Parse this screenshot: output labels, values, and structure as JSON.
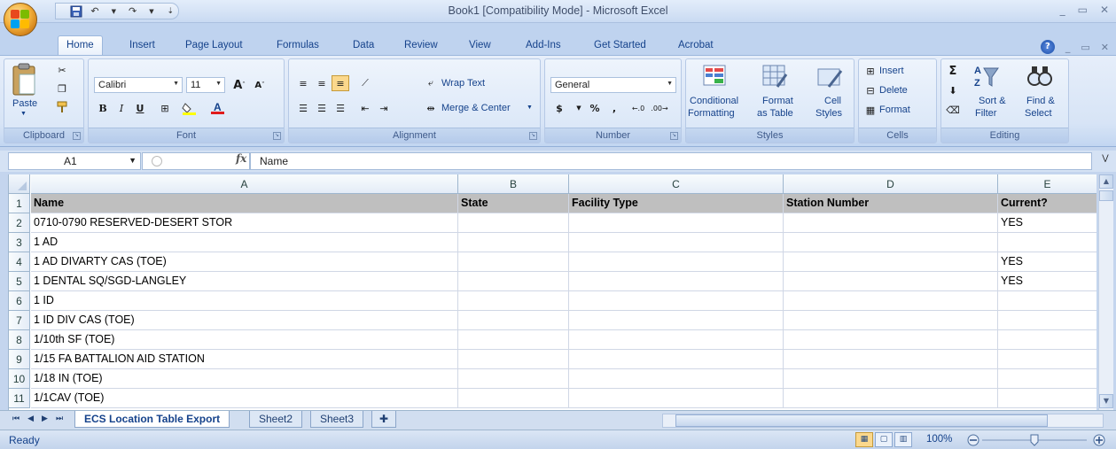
{
  "window": {
    "title": "Book1  [Compatibility Mode] - Microsoft Excel"
  },
  "ribbon_tabs": [
    "Home",
    "Insert",
    "Page Layout",
    "Formulas",
    "Data",
    "Review",
    "View",
    "Add-Ins",
    "Get Started",
    "Acrobat"
  ],
  "clipboard": {
    "label": "Clipboard",
    "paste": "Paste"
  },
  "font": {
    "label": "Font",
    "name": "Calibri",
    "size": "11"
  },
  "alignment": {
    "label": "Alignment",
    "wrap": "Wrap Text",
    "merge": "Merge & Center"
  },
  "number": {
    "label": "Number",
    "format": "General"
  },
  "styles": {
    "label": "Styles",
    "conditional_1": "Conditional",
    "conditional_2": "Formatting",
    "format_table_1": "Format",
    "format_table_2": "as Table",
    "cell_styles_1": "Cell",
    "cell_styles_2": "Styles"
  },
  "cells": {
    "label": "Cells",
    "insert": "Insert",
    "delete": "Delete",
    "format": "Format"
  },
  "editing": {
    "label": "Editing",
    "sort_1": "Sort &",
    "sort_2": "Filter",
    "find_1": "Find &",
    "find_2": "Select"
  },
  "formula_bar": {
    "name_box": "A1",
    "fx": "fx",
    "content": "Name"
  },
  "columns": [
    "A",
    "B",
    "C",
    "D",
    "E"
  ],
  "rows": [
    {
      "num": "1",
      "cells": [
        "Name",
        "State",
        "Facility Type",
        "Station Number",
        "Current?"
      ]
    },
    {
      "num": "2",
      "cells": [
        "0710-0790 RESERVED-DESERT STOR",
        "",
        "",
        "",
        "YES"
      ]
    },
    {
      "num": "3",
      "cells": [
        "1 AD",
        "",
        "",
        "",
        ""
      ]
    },
    {
      "num": "4",
      "cells": [
        "1 AD DIVARTY CAS (TOE)",
        "",
        "",
        "",
        "YES"
      ]
    },
    {
      "num": "5",
      "cells": [
        "1 DENTAL SQ/SGD-LANGLEY",
        "",
        "",
        "",
        "YES"
      ]
    },
    {
      "num": "6",
      "cells": [
        "1 ID",
        "",
        "",
        "",
        ""
      ]
    },
    {
      "num": "7",
      "cells": [
        "1 ID DIV CAS (TOE)",
        "",
        "",
        "",
        ""
      ]
    },
    {
      "num": "8",
      "cells": [
        "1/10th SF (TOE)",
        "",
        "",
        "",
        ""
      ]
    },
    {
      "num": "9",
      "cells": [
        "1/15 FA BATTALION AID STATION",
        "",
        "",
        "",
        ""
      ]
    },
    {
      "num": "10",
      "cells": [
        "1/18 IN (TOE)",
        "",
        "",
        "",
        ""
      ]
    },
    {
      "num": "11",
      "cells": [
        "1/1CAV (TOE)",
        "",
        "",
        "",
        ""
      ]
    }
  ],
  "sheet_tabs": [
    "ECS Location Table Export",
    "Sheet2",
    "Sheet3"
  ],
  "status": {
    "text": "Ready",
    "zoom": "100%"
  }
}
